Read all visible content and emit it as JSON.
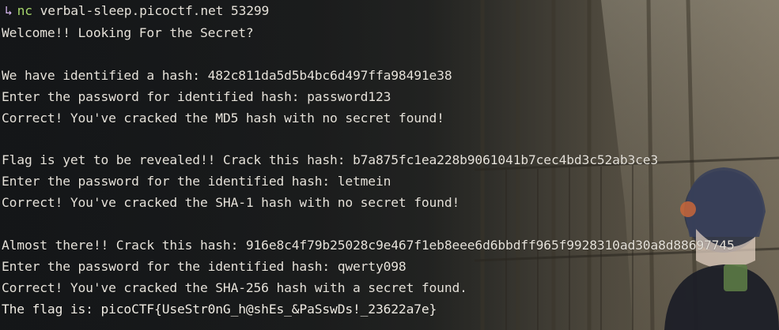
{
  "terminal": {
    "prompt": {
      "arrow": "↳",
      "command": "nc",
      "args": "verbal-sleep.picoctf.net 53299"
    },
    "lines": [
      "Welcome!! Looking For the Secret?",
      "",
      "We have identified a hash: 482c811da5d5b4bc6d497ffa98491e38",
      "Enter the password for identified hash: password123",
      "Correct! You've cracked the MD5 hash with no secret found!",
      "",
      "Flag is yet to be revealed!! Crack this hash: b7a875fc1ea228b9061041b7cec4bd3c52ab3ce3",
      "Enter the password for the identified hash: letmein",
      "Correct! You've cracked the SHA-1 hash with no secret found!",
      "",
      "Almost there!! Crack this hash: 916e8c4f79b25028c9e467f1eb8eee6d6bbdff965f9928310ad30a8d88697745",
      "Enter the password for the identified hash: qwerty098",
      "Correct! You've cracked the SHA-256 hash with a secret found.",
      "The flag is: picoCTF{UseStr0nG_h@shEs_&PaSswDs!_23622a7e}"
    ]
  },
  "colors": {
    "text": "#e6e2da",
    "prompt_arrow": "#d7b8f0",
    "prompt_command": "#a8d86e",
    "background": "#141618"
  },
  "wallpaper": {
    "description_icon": "anime-wallpaper-icon"
  }
}
